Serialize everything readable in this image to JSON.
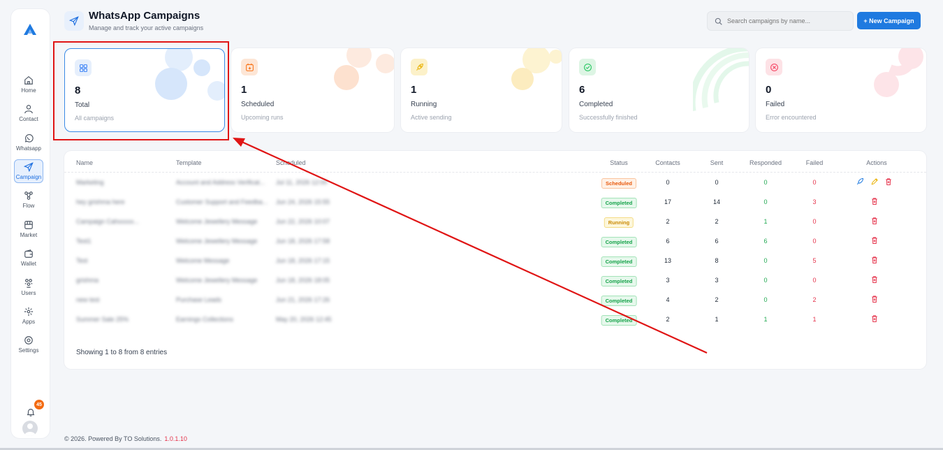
{
  "header": {
    "title": "WhatsApp Campaigns",
    "subtitle": "Manage and track your active campaigns",
    "search_placeholder": "Search campaigns by name...",
    "new_button": "+ New Campaign"
  },
  "sidebar": {
    "items": [
      {
        "label": "Home",
        "icon": "home-icon"
      },
      {
        "label": "Contact",
        "icon": "user-icon"
      },
      {
        "label": "Whatsapp",
        "icon": "whatsapp-icon"
      },
      {
        "label": "Campaign",
        "icon": "send-icon",
        "active": true
      },
      {
        "label": "Flow",
        "icon": "flow-icon"
      },
      {
        "label": "Market",
        "icon": "market-icon"
      },
      {
        "label": "Wallet",
        "icon": "wallet-icon"
      },
      {
        "label": "Users",
        "icon": "users-icon"
      },
      {
        "label": "Apps",
        "icon": "apps-icon"
      },
      {
        "label": "Settings",
        "icon": "settings-icon"
      }
    ],
    "notification_count": "45"
  },
  "stats": [
    {
      "value": "8",
      "label": "Total",
      "sub": "All campaigns",
      "color": "#3b82f6"
    },
    {
      "value": "1",
      "label": "Scheduled",
      "sub": "Upcoming runs",
      "color": "#f97316"
    },
    {
      "value": "1",
      "label": "Running",
      "sub": "Active sending",
      "color": "#eab308"
    },
    {
      "value": "6",
      "label": "Completed",
      "sub": "Successfully finished",
      "color": "#22c55e"
    },
    {
      "value": "0",
      "label": "Failed",
      "sub": "Error encountered",
      "color": "#f43f5e"
    }
  ],
  "table": {
    "columns": [
      "Name",
      "Template",
      "Scheduled",
      "Status",
      "Contacts",
      "Sent",
      "Responded",
      "Failed",
      "Actions"
    ],
    "rows": [
      {
        "name": "Marketing",
        "template": "Account and Address Verificat...",
        "scheduled": "Jul 11, 2026 12:00",
        "status": "Scheduled",
        "contacts": "0",
        "sent": "0",
        "responded": "0",
        "failed": "0"
      },
      {
        "name": "hey grishma here",
        "template": "Customer Support and Feedba...",
        "scheduled": "Jun 24, 2026 15:55",
        "status": "Completed",
        "contacts": "17",
        "sent": "14",
        "responded": "0",
        "failed": "3"
      },
      {
        "name": "Campaign Cahxxxxx...",
        "template": "Welcome Jewellery Message",
        "scheduled": "Jun 22, 2026 10:07",
        "status": "Running",
        "contacts": "2",
        "sent": "2",
        "responded": "1",
        "failed": "0"
      },
      {
        "name": "Test1",
        "template": "Welcome Jewellery Message",
        "scheduled": "Jun 18, 2026 17:58",
        "status": "Completed",
        "contacts": "6",
        "sent": "6",
        "responded": "6",
        "failed": "0"
      },
      {
        "name": "Test",
        "template": "Welcome Message",
        "scheduled": "Jun 18, 2026 17:15",
        "status": "Completed",
        "contacts": "13",
        "sent": "8",
        "responded": "0",
        "failed": "5"
      },
      {
        "name": "grishma",
        "template": "Welcome Jewellery Message",
        "scheduled": "Jun 18, 2026 18:05",
        "status": "Completed",
        "contacts": "3",
        "sent": "3",
        "responded": "0",
        "failed": "0"
      },
      {
        "name": "new test",
        "template": "Purchase Leads",
        "scheduled": "Jun 21, 2026 17:26",
        "status": "Completed",
        "contacts": "4",
        "sent": "2",
        "responded": "0",
        "failed": "2"
      },
      {
        "name": "Summer Sale 25%",
        "template": "Earnings Collections",
        "scheduled": "May 20, 2026 12:45",
        "status": "Completed",
        "contacts": "2",
        "sent": "1",
        "responded": "1",
        "failed": "1"
      }
    ],
    "showing": "Showing 1 to 8 from 8 entries"
  },
  "footer": {
    "text": "© 2026. Powered By TO Solutions.",
    "version": "1.0.1.10"
  }
}
